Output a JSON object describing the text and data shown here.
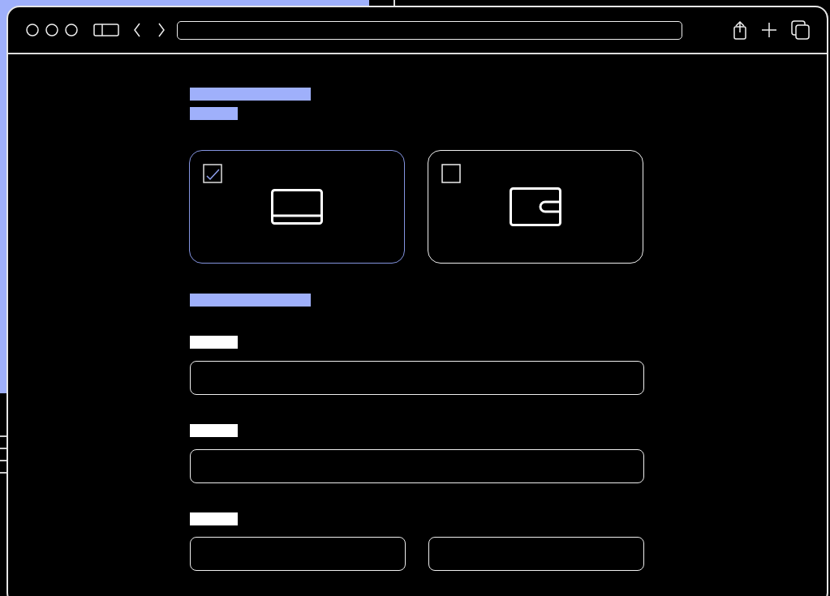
{
  "payment_methods": {
    "options": [
      {
        "kind": "card",
        "selected": true
      },
      {
        "kind": "wallet",
        "selected": false
      }
    ]
  },
  "form_rows": [
    {
      "kind": "single"
    },
    {
      "kind": "single"
    },
    {
      "kind": "split"
    }
  ]
}
